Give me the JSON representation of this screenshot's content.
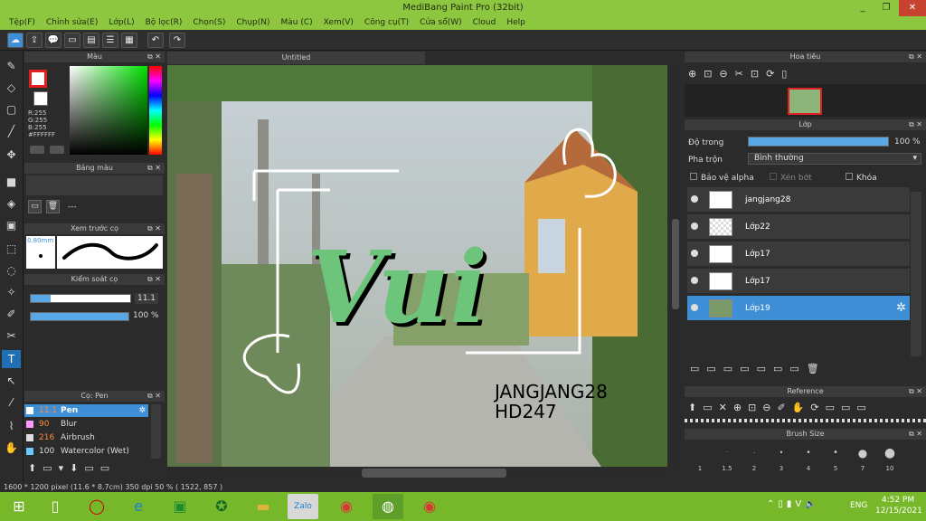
{
  "window": {
    "title": "MediBang Paint Pro (32bit)",
    "min": "_",
    "max": "❐",
    "close": "✕"
  },
  "menu": [
    "Tệp(F)",
    "Chỉnh sửa(E)",
    "Lớp(L)",
    "Bộ lọc(R)",
    "Chọn(S)",
    "Chụp(N)",
    "Màu (C)",
    "Xem(V)",
    "Công cụ(T)",
    "Cửa sổ(W)",
    "Cloud",
    "Help"
  ],
  "color_panel": {
    "title": "Màu",
    "r": "R:255",
    "g": "G:255",
    "b": "B:255",
    "hex": "#FFFFFF"
  },
  "palette_panel": {
    "title": "Bảng màu",
    "dash": "---"
  },
  "brush_preview": {
    "title": "Xem trước cọ",
    "size": "0.80mm"
  },
  "brush_control": {
    "title": "Kiểm soát cọ",
    "size_value": "11.1",
    "opacity_value": "100 %"
  },
  "brush_list": {
    "title": "Cọ: Pen",
    "items": [
      {
        "size": "11.1",
        "name": "Pen",
        "color": "#ffffff"
      },
      {
        "size": "90",
        "name": "Blur",
        "color": "#ff99ff"
      },
      {
        "size": "216",
        "name": "Airbrush",
        "color": "#dddddd"
      },
      {
        "size": "100",
        "name": "Watercolor (Wet)",
        "color": "#66ccff"
      }
    ]
  },
  "canvas": {
    "tab_title": "Untitled",
    "text_main": "Vui",
    "text_line1": "JANGJANG28",
    "text_line2": "HD247"
  },
  "navigator": {
    "title": "Hoa tiêu"
  },
  "layer_panel": {
    "title": "Lớp",
    "opacity_label": "Độ trong",
    "opacity_value": "100 %",
    "blend_label": "Pha trộn",
    "blend_value": "Bình thường",
    "protect_alpha": "Bảo vệ alpha",
    "clipping": "Xén bớt",
    "lock": "Khóa",
    "layers": [
      {
        "name": "jangjang28"
      },
      {
        "name": "Lớp22"
      },
      {
        "name": "Lớp17"
      },
      {
        "name": "Lớp17"
      },
      {
        "name": "Lớp19"
      }
    ]
  },
  "reference_panel": {
    "title": "Reference"
  },
  "brush_size_panel": {
    "title": "Brush Size",
    "sizes": [
      "1",
      "1.5",
      "2",
      "3",
      "4",
      "5",
      "7",
      "10"
    ]
  },
  "status": {
    "text": "1600 * 1200 pixel  (11.6 * 8.7cm)  350 dpi  50 %  ( 1522, 857 )"
  },
  "taskbar": {
    "lang": "ENG",
    "time": "4:52 PM",
    "date": "12/15/2021"
  }
}
